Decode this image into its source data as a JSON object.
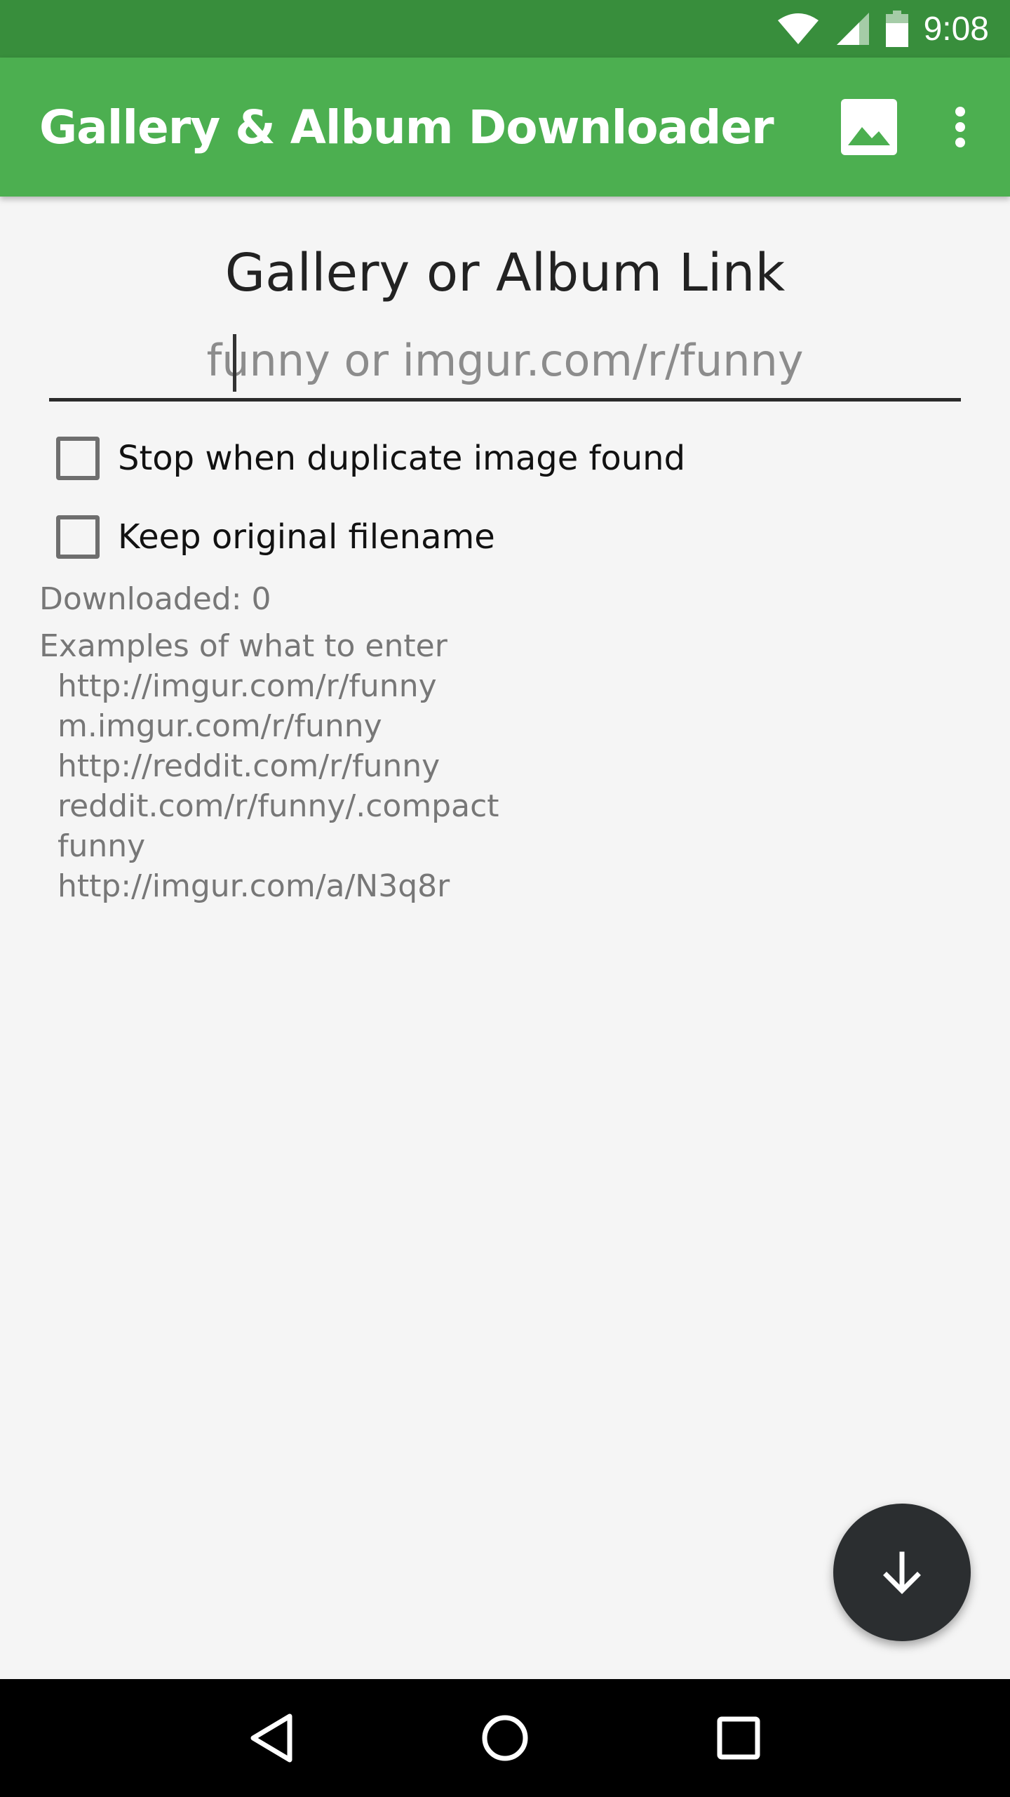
{
  "status_bar": {
    "time": "9:08",
    "icons": [
      "wifi-icon",
      "signal-icon",
      "battery-icon"
    ]
  },
  "app_bar": {
    "title": "Gallery & Album Downloader",
    "actions": [
      "image-icon",
      "more-vert-icon"
    ],
    "color": "#4caf50"
  },
  "main": {
    "heading": "Gallery or Album Link",
    "link_input": {
      "value": "",
      "placeholder": "funny or imgur.com/r/funny"
    },
    "options": [
      {
        "label": "Stop when duplicate image found",
        "checked": false
      },
      {
        "label": "Keep original filename",
        "checked": false
      }
    ],
    "downloaded": "Downloaded: 0",
    "examples_title": "Examples of what to enter",
    "examples": [
      " http://imgur.com/r/funny",
      " m.imgur.com/r/funny",
      " http://reddit.com/r/funny",
      " reddit.com/r/funny/.compact",
      " funny",
      " http://imgur.com/a/N3q8r"
    ]
  },
  "fab": {
    "icon": "arrow-down-icon"
  },
  "nav_bar": {
    "buttons": [
      "back-icon",
      "home-icon",
      "recents-icon"
    ]
  }
}
